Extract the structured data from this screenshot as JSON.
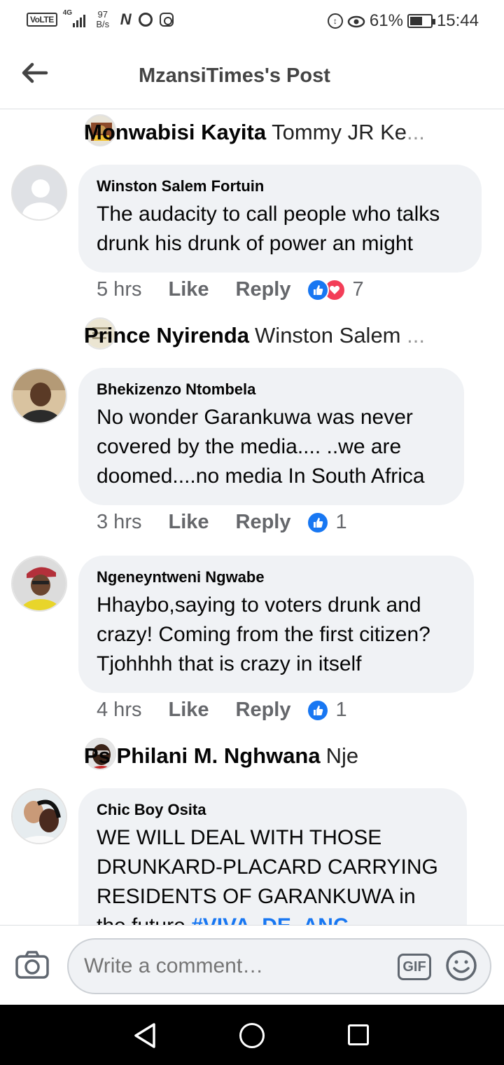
{
  "status_bar": {
    "volte": "VoLTE",
    "network": "4G",
    "speed_value": "97",
    "speed_unit": "B/s",
    "carrier_icon_n": "N",
    "battery_percent": "61%",
    "battery_level": 0.61,
    "time": "15:44"
  },
  "header": {
    "title": "MzansiTimes's Post",
    "back_icon": "arrow-left-icon"
  },
  "comments": [
    {
      "type": "reply_preview",
      "name": "Monwabisi Kayita",
      "text": "Tommy JR Ke",
      "ellipsis": "..."
    },
    {
      "type": "comment",
      "author": "Winston Salem Fortuin",
      "text": "The audacity to call people who talks drunk his drunk of power an might",
      "time": "5 hrs",
      "like": "Like",
      "reply": "Reply",
      "reaction_count": "7",
      "reactions": [
        "like",
        "love"
      ]
    },
    {
      "type": "reply_preview",
      "name": "Prince Nyirenda",
      "text": "Winston Salem",
      "ellipsis": "..."
    },
    {
      "type": "comment",
      "author": "Bhekizenzo Ntombela",
      "text": "No wonder Garankuwa was never covered by the media.... ..we are doomed....no media In South Africa",
      "time": "3 hrs",
      "like": "Like",
      "reply": "Reply",
      "reaction_count": "1",
      "reactions": [
        "like"
      ]
    },
    {
      "type": "comment",
      "author": "Ngeneyntweni Ngwabe",
      "text": "Hhaybo,saying to voters drunk and crazy! Coming from the first citizen? Tjohhhh that is crazy in itself",
      "time": "4 hrs",
      "like": "Like",
      "reply": "Reply",
      "reaction_count": "1",
      "reactions": [
        "like"
      ]
    },
    {
      "type": "reply_preview",
      "name": "Ps Philani M. Nghwana",
      "text": "Nje",
      "ellipsis": ""
    },
    {
      "type": "comment",
      "author": "Chic Boy Osita",
      "text": "WE WILL DEAL WITH THOSE DRUNKARD-PLACARD CARRYING RESIDENTS OF GARANKUWA in the future",
      "hashtag": "#VIVA_DE_ANC"
    }
  ],
  "composer": {
    "placeholder": "Write a comment…",
    "gif_label": "GIF",
    "camera_icon": "camera-icon",
    "emoji_icon": "emoji-icon"
  },
  "colors": {
    "accent": "#1877f2",
    "love": "#f33e58",
    "bubble": "#f0f2f5",
    "meta_text": "#65676b"
  }
}
